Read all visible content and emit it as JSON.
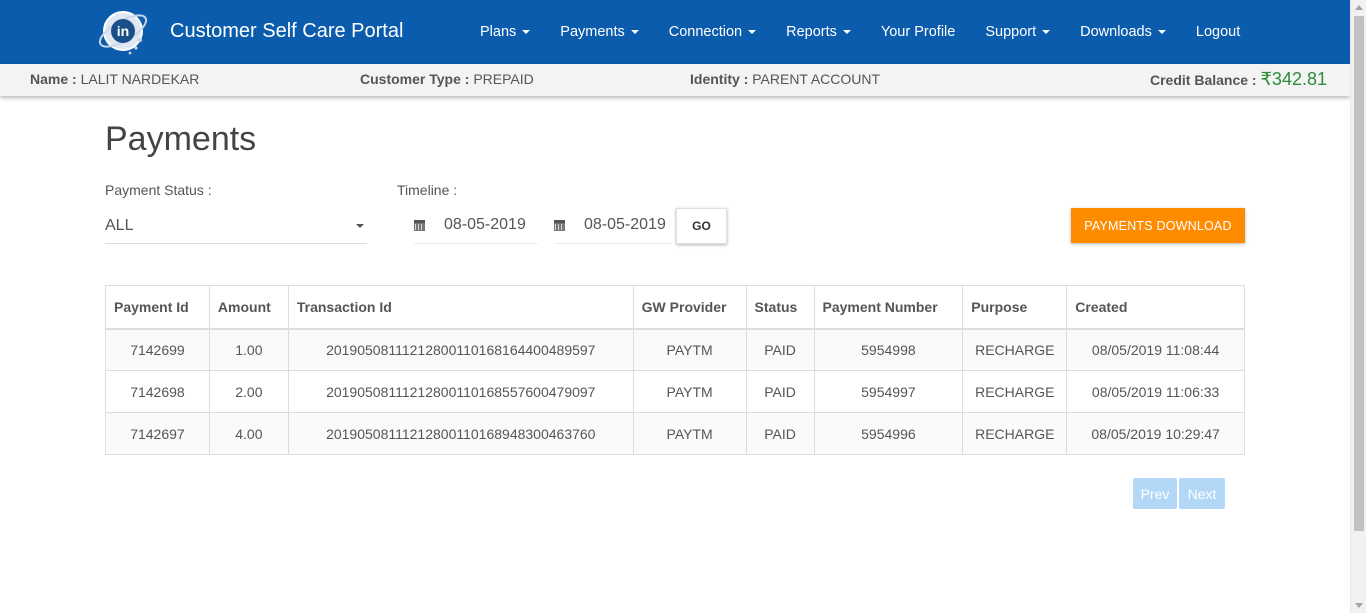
{
  "app": {
    "brand": "Customer Self Care Portal",
    "logo_icon": "globe-logo-icon"
  },
  "nav": {
    "items": [
      {
        "label": "Plans",
        "dropdown": true
      },
      {
        "label": "Payments",
        "dropdown": true
      },
      {
        "label": "Connection",
        "dropdown": true
      },
      {
        "label": "Reports",
        "dropdown": true
      },
      {
        "label": "Your Profile",
        "dropdown": false
      },
      {
        "label": "Support",
        "dropdown": true
      },
      {
        "label": "Downloads",
        "dropdown": true
      },
      {
        "label": "Logout",
        "dropdown": false
      }
    ]
  },
  "info": {
    "name_label": "Name :",
    "name_value": "LALIT NARDEKAR",
    "type_label": "Customer Type :",
    "type_value": "PREPAID",
    "identity_label": "Identity :",
    "identity_value": "PARENT ACCOUNT",
    "balance_label": "Credit Balance :",
    "balance_value": "₹342.81"
  },
  "page": {
    "title": "Payments",
    "status_label": "Payment Status :",
    "status_value": "ALL",
    "timeline_label": "Timeline :",
    "from_date": "08-05-2019",
    "to_date": "08-05-2019",
    "go_label": "GO",
    "download_label": "PAYMENTS DOWNLOAD"
  },
  "table": {
    "headers": [
      "Payment Id",
      "Amount",
      "Transaction Id",
      "GW Provider",
      "Status",
      "Payment Number",
      "Purpose",
      "Created"
    ],
    "rows": [
      [
        "7142699",
        "1.00",
        "20190508111212800110168164400489597",
        "PAYTM",
        "PAID",
        "5954998",
        "RECHARGE",
        "08/05/2019 11:08:44"
      ],
      [
        "7142698",
        "2.00",
        "20190508111212800110168557600479097",
        "PAYTM",
        "PAID",
        "5954997",
        "RECHARGE",
        "08/05/2019 11:06:33"
      ],
      [
        "7142697",
        "4.00",
        "20190508111212800110168948300463760",
        "PAYTM",
        "PAID",
        "5954996",
        "RECHARGE",
        "08/05/2019 10:29:47"
      ]
    ]
  },
  "pager": {
    "prev_label": "Prev",
    "next_label": "Next"
  },
  "colors": {
    "navbar": "#0b5cad",
    "accent_orange": "#ff8c00",
    "balance_green": "#2e8b3a",
    "pager_disabled": "#b3d7f7"
  }
}
